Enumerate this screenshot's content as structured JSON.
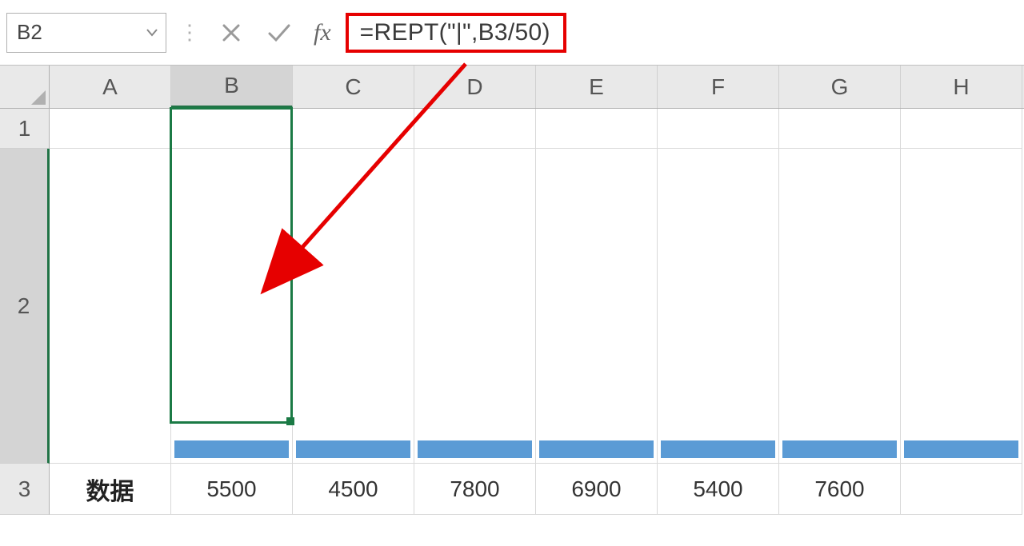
{
  "formula_bar": {
    "cell_ref": "B2",
    "fx_label": "fx",
    "formula": "=REPT(\"|\",B3/50)"
  },
  "columns": [
    "A",
    "B",
    "C",
    "D",
    "E",
    "F",
    "G",
    "H"
  ],
  "active_column": "B",
  "rows": [
    "1",
    "2",
    "3"
  ],
  "active_row": "2",
  "row3_label": "数据",
  "data_values": [
    5500,
    4500,
    7800,
    6900,
    5400,
    7600
  ],
  "colors": {
    "bar": "#5b9bd5",
    "selection": "#1b7a45",
    "highlight_border": "#e60000"
  },
  "chart_data": {
    "type": "bar",
    "categories": [
      "B",
      "C",
      "D",
      "E",
      "F",
      "G"
    ],
    "values": [
      5500,
      4500,
      7800,
      6900,
      5400,
      7600
    ],
    "title": "",
    "xlabel": "",
    "ylabel": "",
    "note": "horizontal pipe-character bars generated inline; uniform visible height in row 2"
  }
}
